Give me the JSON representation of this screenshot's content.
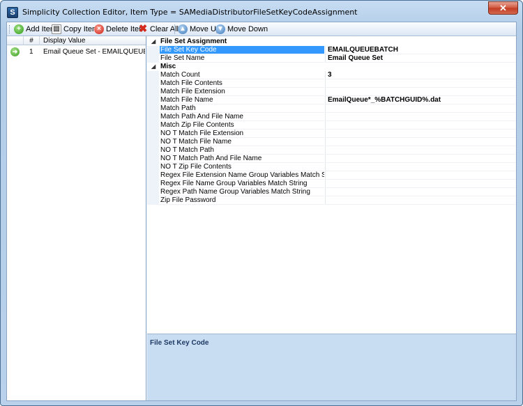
{
  "window": {
    "title": "Simplicity Collection Editor, Item Type = SAMediaDistributorFileSetKeyCodeAssignment",
    "close_glyph": "✕",
    "app_icon_letter": "S"
  },
  "toolbar": {
    "add": "Add Item",
    "copy": "Copy Item",
    "delete": "Delete Item",
    "clear": "Clear All",
    "move_up": "Move Up",
    "move_down": "Move Down"
  },
  "list": {
    "col_num": "#",
    "col_display": "Display Value",
    "rows": [
      {
        "num": "1",
        "display": "Email Queue Set - EMAILQUEUEBAT..."
      }
    ]
  },
  "properties": {
    "cat1": "File Set Assignment",
    "cat1_rows": [
      {
        "name": "File Set Key Code",
        "value": "EMAILQUEUEBATCH"
      },
      {
        "name": "File Set Name",
        "value": "Email Queue Set"
      }
    ],
    "cat2": "Misc",
    "cat2_rows": [
      {
        "name": "Match Count",
        "value": "3"
      },
      {
        "name": "Match File Contents",
        "value": ""
      },
      {
        "name": "Match File Extension",
        "value": ""
      },
      {
        "name": "Match File Name",
        "value": "EmailQueue*_%BATCHGUID%.dat"
      },
      {
        "name": "Match Path",
        "value": ""
      },
      {
        "name": "Match Path And File Name",
        "value": ""
      },
      {
        "name": "Match Zip File Contents",
        "value": ""
      },
      {
        "name": "NO T Match File Extension",
        "value": ""
      },
      {
        "name": "NO T Match File Name",
        "value": ""
      },
      {
        "name": "NO T Match Path",
        "value": ""
      },
      {
        "name": "NO T Match Path And File Name",
        "value": ""
      },
      {
        "name": "NO T Zip File Contents",
        "value": ""
      },
      {
        "name": "Regex File Extension Name Group Variables Match String",
        "value": ""
      },
      {
        "name": "Regex File Name Group Variables Match String",
        "value": ""
      },
      {
        "name": "Regex Path Name Group Variables Match String",
        "value": ""
      },
      {
        "name": "Zip File Password",
        "value": ""
      }
    ]
  },
  "description": {
    "title": "File Set Key Code"
  },
  "colors": {
    "selection": "#3399ff",
    "desc_bg": "#c8dcf2",
    "desc_title": "#1f3b63"
  }
}
